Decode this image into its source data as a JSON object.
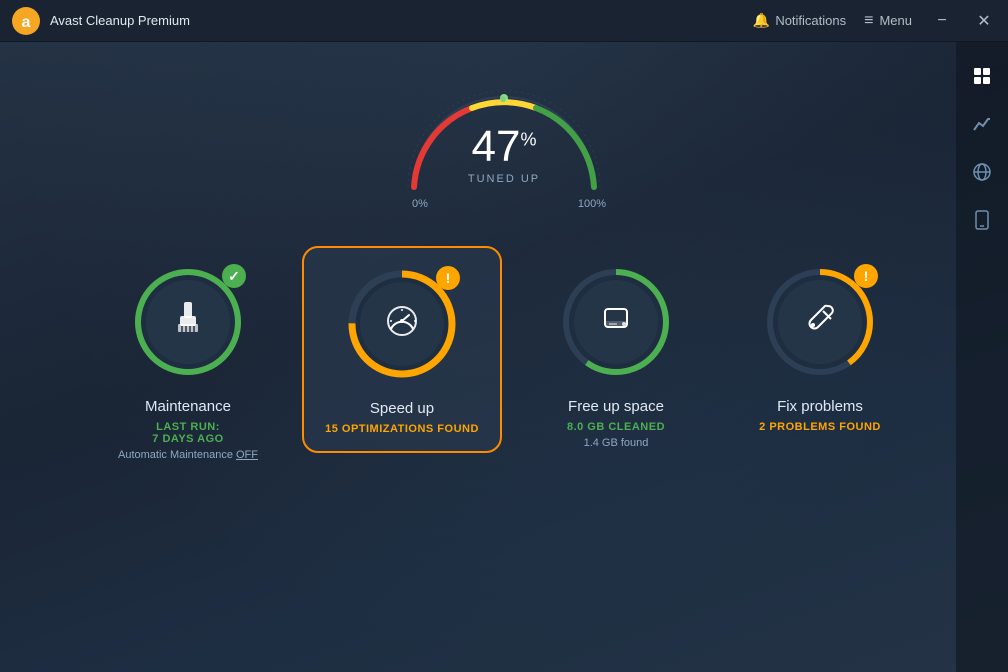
{
  "app": {
    "title": "Avast Cleanup Premium",
    "logo_color": "#f5a623"
  },
  "titlebar": {
    "notifications_label": "Notifications",
    "menu_label": "Menu",
    "minimize_label": "−",
    "close_label": "✕"
  },
  "gauge": {
    "value": "47",
    "unit": "%",
    "label": "TUNED UP",
    "min_label": "0%",
    "max_label": "100%",
    "color_start": "#e53935",
    "color_mid": "#fdd835",
    "color_end": "#43a047",
    "fill_angle": 47
  },
  "cards": [
    {
      "id": "maintenance",
      "title": "Maintenance",
      "subtitle_line1": "LAST RUN:",
      "subtitle_line2": "7 DAYS AGO",
      "note": "Automatic Maintenance OFF",
      "badge_type": "check",
      "circle_color": "#4caf50",
      "selected": false
    },
    {
      "id": "speed-up",
      "title": "Speed up",
      "subtitle": "15 OPTIMIZATIONS FOUND",
      "subtitle_color": "orange",
      "badge_type": "warn",
      "circle_color": "#ffa500",
      "selected": true
    },
    {
      "id": "free-space",
      "title": "Free up space",
      "subtitle": "8.0 GB CLEANED",
      "subtitle_color": "green",
      "note": "1.4 GB found",
      "badge_type": "none",
      "circle_color": "#4caf50",
      "selected": false
    },
    {
      "id": "fix-problems",
      "title": "Fix problems",
      "subtitle": "2 PROBLEMS FOUND",
      "subtitle_color": "orange",
      "badge_type": "warn",
      "circle_color": "#ffa500",
      "selected": false
    }
  ],
  "sidebar": {
    "items": [
      {
        "id": "grid",
        "icon": "⊞",
        "active": true
      },
      {
        "id": "chart",
        "icon": "📈",
        "active": false
      },
      {
        "id": "globe",
        "icon": "🌐",
        "active": false
      },
      {
        "id": "phone",
        "icon": "📱",
        "active": false
      }
    ]
  }
}
